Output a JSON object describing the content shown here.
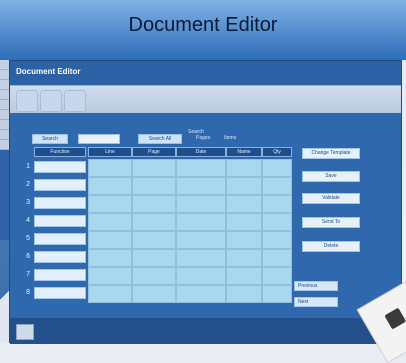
{
  "banner": {
    "title": "Document Editor"
  },
  "window": {
    "title": "Document Editor",
    "controls": {
      "search_label": "Search",
      "search_value": "",
      "filter_label": "Search All",
      "note_lines": [
        "Search",
        "Pages",
        "Items"
      ]
    },
    "columns": [
      "Function",
      "Line",
      "Page",
      "Date",
      "Name",
      "Qty"
    ],
    "row_numbers": [
      "1",
      "2",
      "3",
      "4",
      "5",
      "6",
      "7",
      "8"
    ],
    "side_buttons": [
      "Change Template",
      "Save",
      "Validate",
      "Send To",
      "Delete"
    ],
    "nav_buttons": [
      "Previous",
      "Next"
    ]
  },
  "colors": {
    "accent": "#2e64a8",
    "cell": "#a9d7ee",
    "header": "#1d4f8f"
  }
}
